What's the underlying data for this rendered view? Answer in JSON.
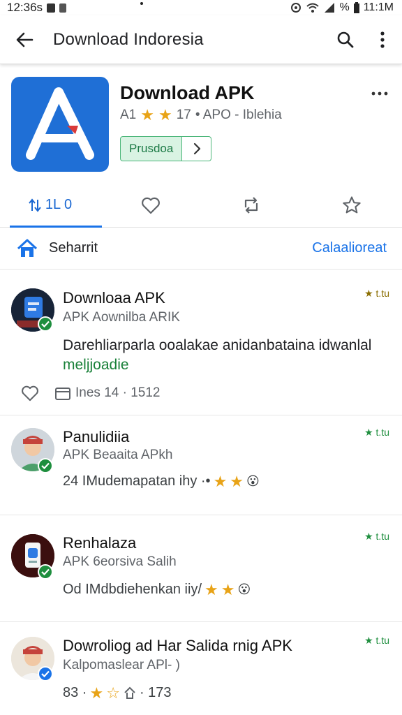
{
  "status_bar": {
    "time": "12:36s",
    "battery": "%",
    "right_time": "11:1M"
  },
  "app_bar": {
    "title": "Download Indoresia"
  },
  "app": {
    "name": "Download APK",
    "rating": "A1",
    "meta_count": "17",
    "meta_text": "• APO - Iblehia",
    "install_label": "Prusdoa"
  },
  "tabs": [
    {
      "label": "1L 0",
      "icon": "sort-icon"
    },
    {
      "label": "",
      "icon": "heart-icon"
    },
    {
      "label": "",
      "icon": "repost-icon"
    },
    {
      "label": "",
      "icon": "star-outline-icon"
    }
  ],
  "sort_row": {
    "label": "Seharrit",
    "action": "Calaalioreat"
  },
  "reviews": [
    {
      "name": "Downloaa APK",
      "subtitle": "APK Aownilba ARIK",
      "rating": "★ t.tu",
      "body": "Darehliarparla ooalakae anidanbataina idwanlal",
      "body_highlight": "meljjoadie",
      "date": "Ines 14 · 1512",
      "badge_color": "#1e8e3e"
    },
    {
      "name": "Panulidiia",
      "subtitle": "APK Beaaita APkh",
      "rating": "★ t.tu",
      "line": "24 IMudemapatan ihy ·•",
      "badge_color": "#1e8e3e"
    },
    {
      "name": "Renhalaza",
      "subtitle": "APK 6eorsiva Salih",
      "rating": "★ t.tu",
      "line": "Od IMdbdiehenkan iiy/",
      "badge_color": "#1e8e3e"
    },
    {
      "name": "Dowroliog ad Har Salida rnig APK",
      "subtitle": "Kalpomaslear APl- )",
      "rating": "★ t.tu",
      "line": "83 ·",
      "line_tail": "· 173",
      "badge_color": "#1a73e8"
    }
  ],
  "colors": {
    "accent": "#1a73e8",
    "app_icon": "#1f6fd6",
    "install_green": "#1c7a46",
    "star": "#e8a317",
    "rating_green": "#1e8e3e"
  }
}
